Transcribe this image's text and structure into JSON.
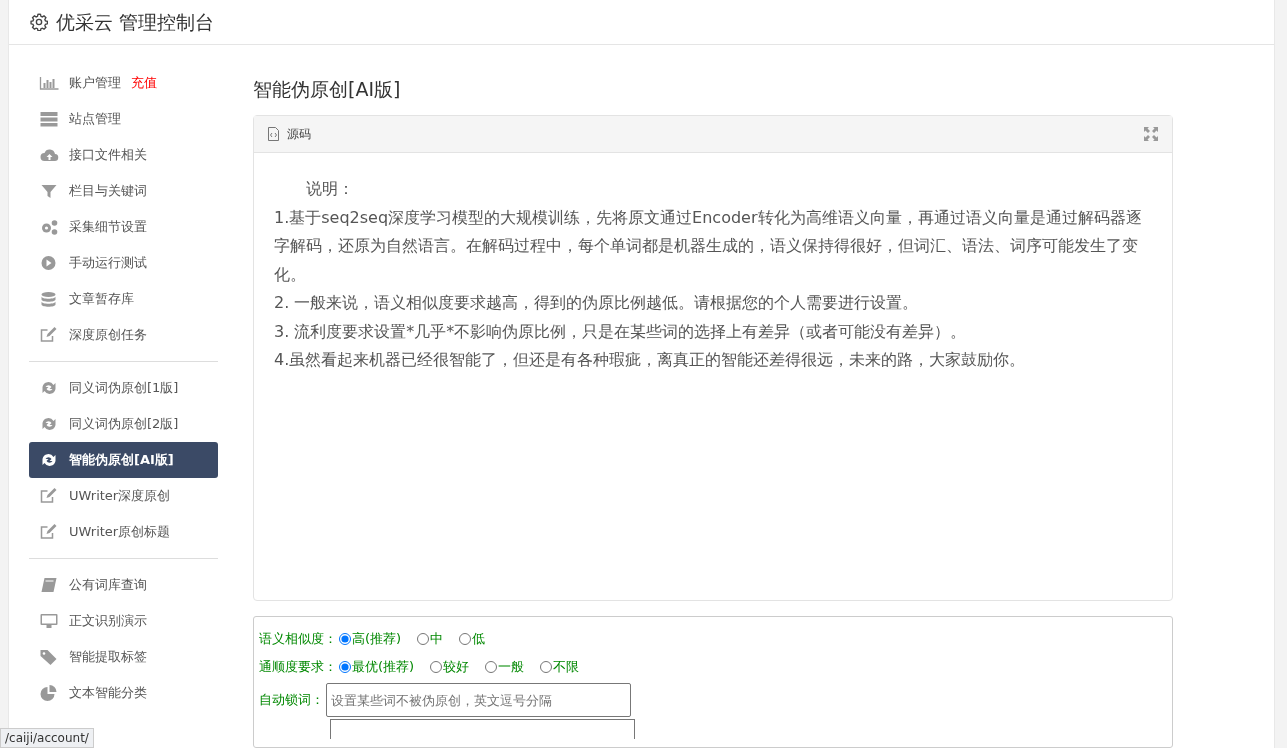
{
  "header": {
    "title": "优采云 管理控制台"
  },
  "sidebar": {
    "groups": [
      {
        "items": [
          {
            "kind": "bars",
            "label": "账户管理",
            "badge": "充值",
            "selected": false
          },
          {
            "kind": "server",
            "label": "站点管理",
            "selected": false
          },
          {
            "kind": "cloud",
            "label": "接口文件相关",
            "selected": false
          },
          {
            "kind": "filter",
            "label": "栏目与关键词",
            "selected": false
          },
          {
            "kind": "gears",
            "label": "采集细节设置",
            "selected": false
          },
          {
            "kind": "play",
            "label": "手动运行测试",
            "selected": false
          },
          {
            "kind": "database",
            "label": "文章暂存库",
            "selected": false
          },
          {
            "kind": "edit",
            "label": "深度原创任务",
            "selected": false
          }
        ]
      },
      {
        "items": [
          {
            "kind": "refresh",
            "label": "同义词伪原创[1版]",
            "selected": false
          },
          {
            "kind": "refresh",
            "label": "同义词伪原创[2版]",
            "selected": false
          },
          {
            "kind": "refresh",
            "label": "智能伪原创[AI版]",
            "selected": true
          },
          {
            "kind": "edit",
            "label": "UWriter深度原创",
            "selected": false
          },
          {
            "kind": "edit",
            "label": "UWriter原创标题",
            "selected": false
          }
        ]
      },
      {
        "items": [
          {
            "kind": "book",
            "label": "公有词库查询",
            "selected": false
          },
          {
            "kind": "monitor",
            "label": "正文识别演示",
            "selected": false
          },
          {
            "kind": "tag",
            "label": "智能提取标签",
            "selected": false
          },
          {
            "kind": "pie",
            "label": "文本智能分类",
            "selected": false
          }
        ]
      }
    ]
  },
  "page_title": "智能伪原创[AI版]",
  "source_panel": {
    "title": "源码",
    "lines": [
      "说明：",
      "1.基于seq2seq深度学习模型的大规模训练，先将原文通过Encoder转化为高维语义向量，再通过语义向量是通过解码器逐字解码，还原为自然语言。在解码过程中，每个单词都是机器生成的，语义保持得很好，但词汇、语法、词序可能发生了变化。",
      "2. 一般来说，语义相似度要求越高，得到的伪原比例越低。请根据您的个人需要进行设置。",
      "3. 流利度要求设置*几乎*不影响伪原比例，只是在某些词的选择上有差异（或者可能没有差异）。",
      "4.虽然看起来机器已经很智能了，但还是有各种瑕疵，离真正的智能还差得很远，未来的路，大家鼓励你。"
    ]
  },
  "options": [
    {
      "label": "语义相似度：",
      "choices": [
        {
          "label": "高(推荐)",
          "selected": true
        },
        {
          "label": "中",
          "selected": false
        },
        {
          "label": "低",
          "selected": false
        }
      ]
    },
    {
      "label": "通顺度要求：",
      "choices": [
        {
          "label": "最优(推荐)",
          "selected": true
        },
        {
          "label": "较好",
          "selected": false
        },
        {
          "label": "一般",
          "selected": false
        },
        {
          "label": "不限",
          "selected": false
        }
      ]
    }
  ],
  "lock_words": {
    "label": "自动锁词：",
    "placeholder": "设置某些词不被伪原创，英文逗号分隔"
  },
  "status_bar": {
    "url": "/caiji/account/"
  }
}
